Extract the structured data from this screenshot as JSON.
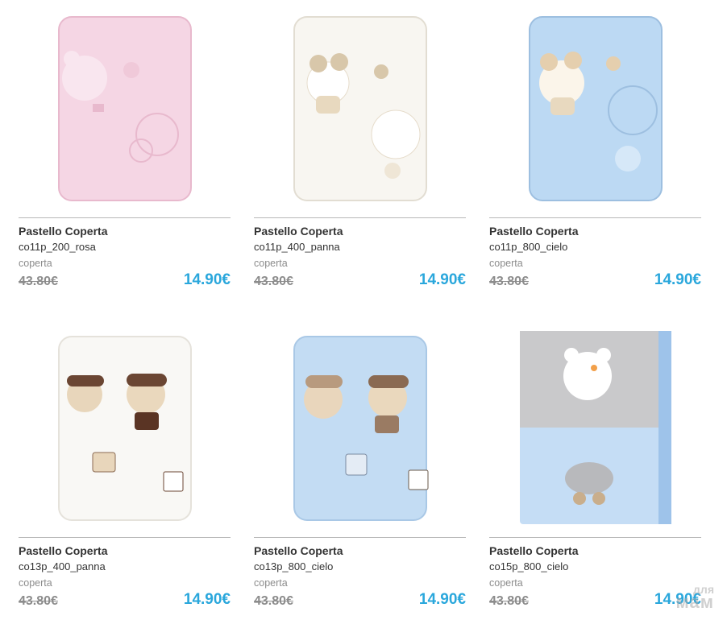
{
  "products": [
    {
      "brand": "Pastello Coperta",
      "sku": "co11p_200_rosa",
      "category": "coperta",
      "old_price": "43.80€",
      "price": "14.90€",
      "colors": {
        "base": "#f5d6e4",
        "accent": "#f9e6ef",
        "trim": "#e8b9cd"
      },
      "icon": "pink-bear-blanket-icon"
    },
    {
      "brand": "Pastello Coperta",
      "sku": "co11p_400_panna",
      "category": "coperta",
      "old_price": "43.80€",
      "price": "14.90€",
      "colors": {
        "base": "#f8f6f1",
        "accent": "#ffffff",
        "trim": "#d8c7aa"
      },
      "icon": "cream-bear-blanket-icon"
    },
    {
      "brand": "Pastello Coperta",
      "sku": "co11p_800_cielo",
      "category": "coperta",
      "old_price": "43.80€",
      "price": "14.90€",
      "colors": {
        "base": "#bcd9f3",
        "accent": "#d6e8f8",
        "trim": "#9dbfe0"
      },
      "icon": "blue-bear-blanket-icon"
    },
    {
      "brand": "Pastello Coperta",
      "sku": "co13p_400_panna",
      "category": "coperta",
      "old_price": "43.80€",
      "price": "14.90€",
      "colors": {
        "base": "#f9f8f5",
        "accent": "#ffffff",
        "trim": "#6b4633"
      },
      "icon": "cream-friends-blanket-icon"
    },
    {
      "brand": "Pastello Coperta",
      "sku": "co13p_800_cielo",
      "category": "coperta",
      "old_price": "43.80€",
      "price": "14.90€",
      "colors": {
        "base": "#c3dcf3",
        "accent": "#d9e9f8",
        "trim": "#8a6a52"
      },
      "icon": "blue-friends-blanket-icon"
    },
    {
      "brand": "Pastello Coperta",
      "sku": "co15p_800_cielo",
      "category": "coperta",
      "old_price": "43.80€",
      "price": "14.90€",
      "colors": {
        "base": "#c5ddf5",
        "accent": "#c9c9cb",
        "trim": "#9ec3ea"
      },
      "icon": "grey-blue-elephant-blanket-icon"
    }
  ],
  "watermark": {
    "line1": "для",
    "line2": "мам"
  }
}
